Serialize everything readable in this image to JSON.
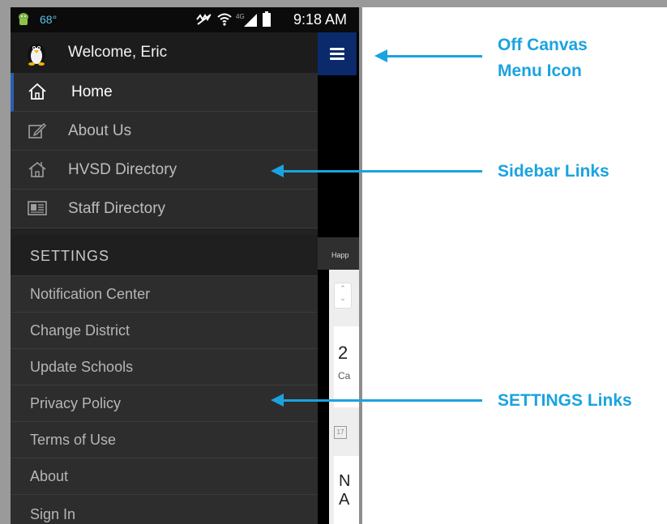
{
  "status_bar": {
    "temperature": "68°",
    "time": "9:18 AM",
    "icons": [
      "android-icon",
      "mute-icon",
      "wifi-icon",
      "signal-4g-icon",
      "battery-icon"
    ]
  },
  "drawer": {
    "welcome": "Welcome,  Eric",
    "nav_items": [
      {
        "label": "Home",
        "icon": "home-icon",
        "active": true
      },
      {
        "label": "About Us",
        "icon": "edit-icon",
        "active": false
      },
      {
        "label": "HVSD Directory",
        "icon": "school-icon",
        "active": false
      },
      {
        "label": "Staff Directory",
        "icon": "id-card-icon",
        "active": false
      }
    ],
    "settings_header": "SETTINGS",
    "settings_items": [
      "Notification Center",
      "Change District",
      "Update Schools",
      "Privacy Policy",
      "Terms of Use",
      "About",
      "Sign In"
    ]
  },
  "background_content": {
    "banner_peek": "Happ",
    "card1_number": "2",
    "card1_sub": "Ca",
    "card2_text": "N\nA"
  },
  "annotations": {
    "menu_icon": "Off Canvas\nMenu Icon",
    "sidebar_links": "Sidebar Links",
    "settings_links": "SETTINGS Links"
  },
  "colors": {
    "accent": "#1aa3e0",
    "menu_button": "#0a2a6b",
    "active_indicator": "#2a5fb0",
    "drawer_bg": "#2b2b2b"
  }
}
